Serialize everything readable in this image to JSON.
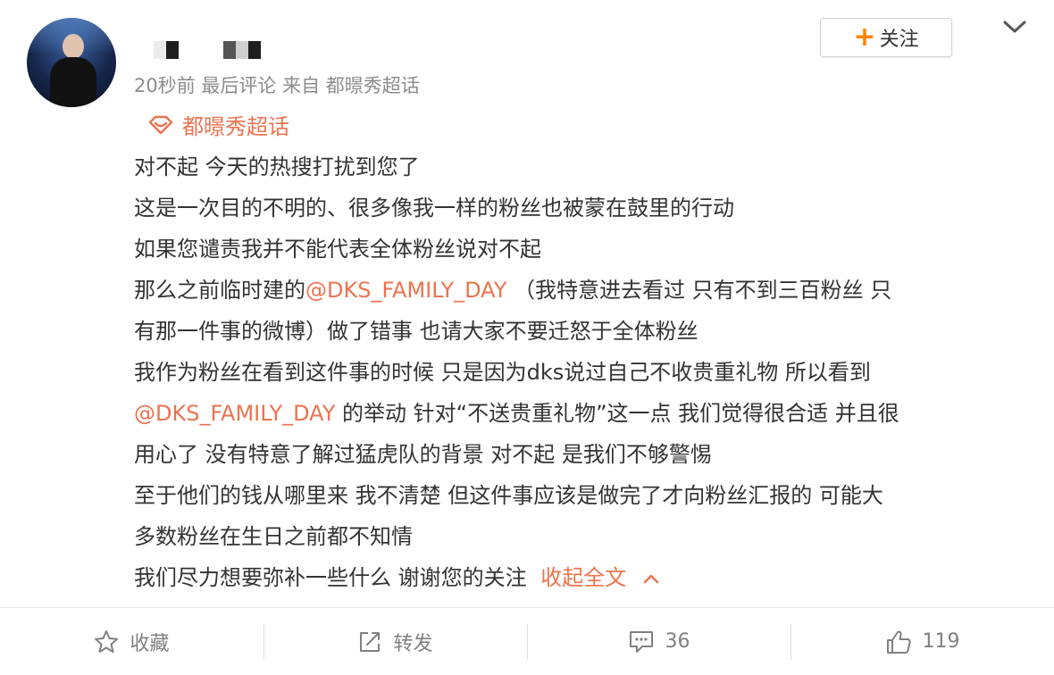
{
  "post": {
    "meta": "20秒前  最后评论  来自  都暻秀超话",
    "follow_label": "关注",
    "topic": "都暻秀超话",
    "lines": [
      "对不起 今天的热搜打扰到您了",
      "这是一次目的不明的、很多像我一样的粉丝也被蒙在鼓里的行动",
      "如果您谴责我并不能代表全体粉丝说对不起"
    ],
    "line4_before": "那么之前临时建的",
    "mention": "@DKS_FAMILY_DAY",
    "line4_after": " （我特意进去看过 只有不到三百粉丝 只",
    "line5": "有那一件事的微博）做了错事 也请大家不要迁怒于全体粉丝",
    "line6": "我作为粉丝在看到这件事的时候 只是因为dks说过自己不收贵重礼物 所以看到",
    "line7_after": " 的举动 针对“不送贵重礼物”这一点 我们觉得很合适 并且很",
    "line8": "用心了 没有特意了解过猛虎队的背景 对不起 是我们不够警惕",
    "line9": "至于他们的钱从哪里来 我不清楚 但这件事应该是做完了才向粉丝汇报的 可能大",
    "line10": "多数粉丝在生日之前都不知情",
    "line11": "我们尽力想要弥补一些什么 谢谢您的关注 ",
    "collapse_label": "收起全文"
  },
  "actions": {
    "favorite": "收藏",
    "repost": "转发",
    "comments": "36",
    "likes": "119"
  },
  "colors": {
    "accent": "#eb7350",
    "follow_plus": "#ff8200",
    "meta_gray": "#8c8c8c"
  },
  "icons": [
    "star-icon",
    "repost-icon",
    "comment-icon",
    "like-icon",
    "chevron-down-icon",
    "chevron-up-icon",
    "supertopic-icon",
    "plus-icon"
  ]
}
